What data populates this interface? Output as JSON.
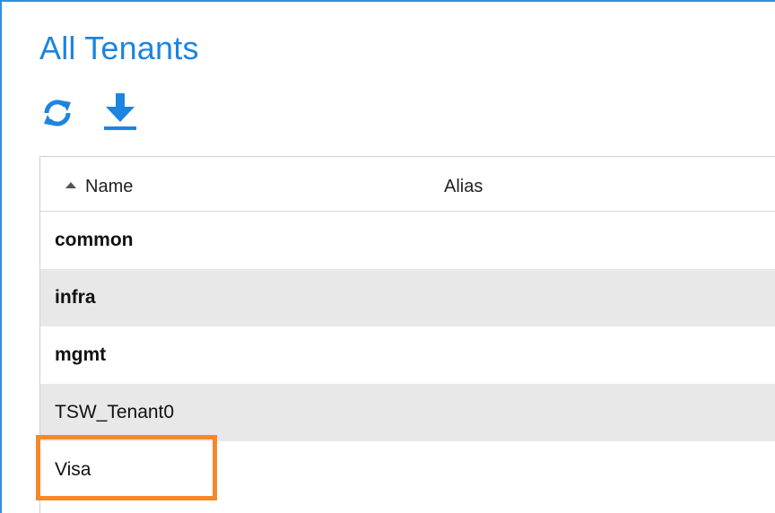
{
  "page": {
    "title": "All Tenants"
  },
  "toolbar": {
    "refresh_icon": "refresh-icon",
    "download_icon": "download-icon",
    "accent_color": "#1d84e0"
  },
  "table": {
    "columns": [
      {
        "label": "Name",
        "sort": "ascending"
      },
      {
        "label": "Alias"
      }
    ],
    "rows": [
      {
        "name": "common",
        "alias": "",
        "bold": true
      },
      {
        "name": "infra",
        "alias": "",
        "bold": true
      },
      {
        "name": "mgmt",
        "alias": "",
        "bold": true
      },
      {
        "name": "TSW_Tenant0",
        "alias": "",
        "bold": false
      },
      {
        "name": "Visa",
        "alias": "",
        "bold": false,
        "highlighted": true
      }
    ]
  },
  "highlight": {
    "color": "#f5882a"
  }
}
